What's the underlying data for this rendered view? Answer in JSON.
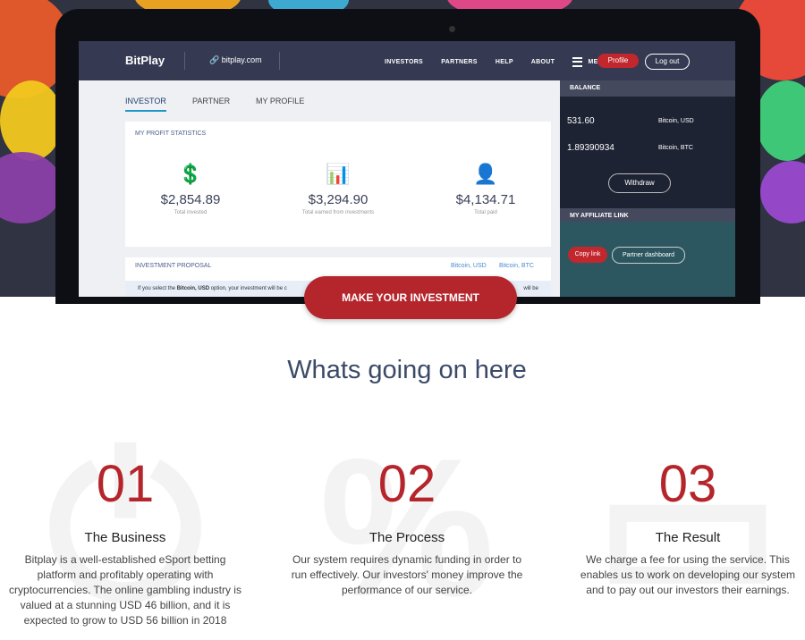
{
  "app": {
    "brand": "BitPlay",
    "site": "bitplay.com"
  },
  "nav": {
    "links": [
      "INVESTORS",
      "PARTNERS",
      "HELP",
      "ABOUT"
    ],
    "menu": "MENU",
    "profile": "Profile",
    "logout": "Log out"
  },
  "tabs": [
    "INVESTOR",
    "PARTNER",
    "MY PROFILE"
  ],
  "stats": {
    "title": "MY PROFIT STATISTICS",
    "items": [
      {
        "value": "$2,854.89",
        "label": "Total invested",
        "icon": "money-hand-icon"
      },
      {
        "value": "$3,294.90",
        "label": "Total earned from investments",
        "icon": "bar-chart-up-icon"
      },
      {
        "value": "$4,134.71",
        "label": "Total paid",
        "icon": "person-growth-icon"
      }
    ]
  },
  "proposal": {
    "title": "INVESTMENT PROPOSAL",
    "opt1": "Bitcoin, USD",
    "opt2": "Bitcoin, BTC",
    "note_pre": "If you select the ",
    "note_bold": "Bitcoin, USD",
    "note_post": " option, your investment will be c",
    "note_end": "will be"
  },
  "balance": {
    "title": "BALANCE",
    "rows": [
      {
        "amount": "531.60",
        "currency": "Bitcoin, USD"
      },
      {
        "amount": "1.89390934",
        "currency": "Bitcoin, BTC"
      }
    ],
    "withdraw": "Withdraw"
  },
  "affiliate": {
    "title": "MY AFFILIATE LINK",
    "copy": "Copy link",
    "dashboard": "Partner dashboard"
  },
  "cta": "MAKE YOUR INVESTMENT",
  "section_title": "Whats going on here",
  "features": [
    {
      "num": "01",
      "title": "The Business",
      "text": "Bitplay is a well-established eSport betting platform and profitably operating with cryptocurrencies. The online gambling industry is valued at a stunning USD 46 billion, and it is expected to grow to USD 56 billion in 2018"
    },
    {
      "num": "02",
      "title": "The Process",
      "text": "Our system requires dynamic funding in order to run effectively. Our investors' money improve the performance of our service."
    },
    {
      "num": "03",
      "title": "The Result",
      "text": "We charge a fee for using the service. This enables us to work on developing our system and to pay out our investors their earnings."
    }
  ],
  "colors": {
    "accent": "#b5262c",
    "nav": "#353a52",
    "hero": "#2f3342"
  }
}
